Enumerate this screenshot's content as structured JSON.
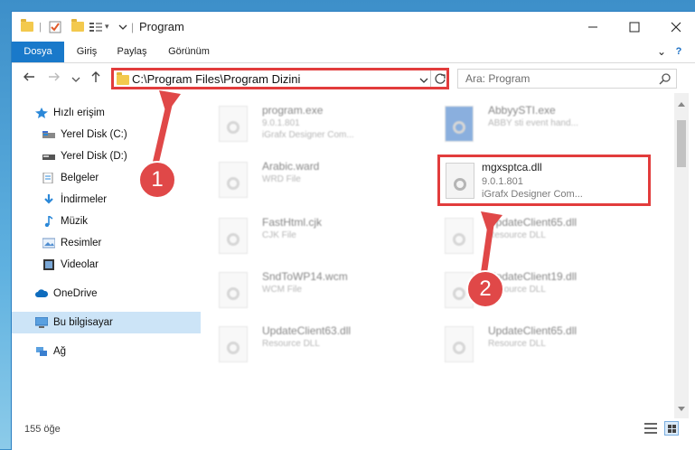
{
  "window": {
    "title": "Program",
    "quick_access_dropdown": "▾"
  },
  "ribbon": {
    "tabs": [
      {
        "label": "Dosya",
        "active": true
      },
      {
        "label": "Giriş"
      },
      {
        "label": "Paylaş"
      },
      {
        "label": "Görünüm"
      }
    ],
    "help": "?",
    "collapse": "⌄"
  },
  "address": {
    "path": "C:\\Program Files\\Program Dizini",
    "search_placeholder": "Ara: Program"
  },
  "sidebar": {
    "items": [
      {
        "label": "Hızlı erişim",
        "icon": "star-icon"
      },
      {
        "label": "Yerel Disk (C:)",
        "icon": "drive-icon",
        "pinned": true
      },
      {
        "label": "Yerel Disk (D:)",
        "icon": "drive-icon",
        "pinned": true
      },
      {
        "label": "Belgeler",
        "icon": "documents-icon",
        "pinned": true
      },
      {
        "label": "İndirmeler",
        "icon": "download-icon",
        "pinned": true
      },
      {
        "label": "Müzik",
        "icon": "music-icon",
        "pinned": true
      },
      {
        "label": "Resimler",
        "icon": "pictures-icon",
        "pinned": true
      },
      {
        "label": "Videolar",
        "icon": "video-icon",
        "pinned": true
      },
      {
        "label": "OneDrive",
        "icon": "cloud-icon"
      },
      {
        "label": "Bu bilgisayar",
        "icon": "computer-icon",
        "selected": true
      },
      {
        "label": "Ağ",
        "icon": "network-icon"
      }
    ]
  },
  "files": [
    {
      "name": "program.exe",
      "type": "9.0.1.801",
      "sub": "iGrafx Designer Com..."
    },
    {
      "name": "AbbyySTI.exe",
      "type": "ABBY sti event hand..."
    },
    {
      "name": "Arabic.ward",
      "type": "WRD File"
    },
    {
      "name": "mgxsptca.dll",
      "type": "9.0.1.801",
      "sub": "iGrafx Designer Com...",
      "highlighted": true
    },
    {
      "name": "FastHtml.cjk",
      "type": "CJK File"
    },
    {
      "name": "UpdateClient65.dll",
      "type": "Resource DLL"
    },
    {
      "name": "SndToWP14.wcm",
      "type": "WCM File"
    },
    {
      "name": "UpdateClient19.dll",
      "type": "Resource DLL"
    },
    {
      "name": "UpdateClient63.dll",
      "type": "Resource DLL"
    },
    {
      "name": "UpdateClient65.dll",
      "type": "Resource DLL"
    }
  ],
  "status": {
    "count": "155 öğe"
  },
  "annotations": {
    "step1": "1",
    "step2": "2",
    "color": "#e04848"
  }
}
